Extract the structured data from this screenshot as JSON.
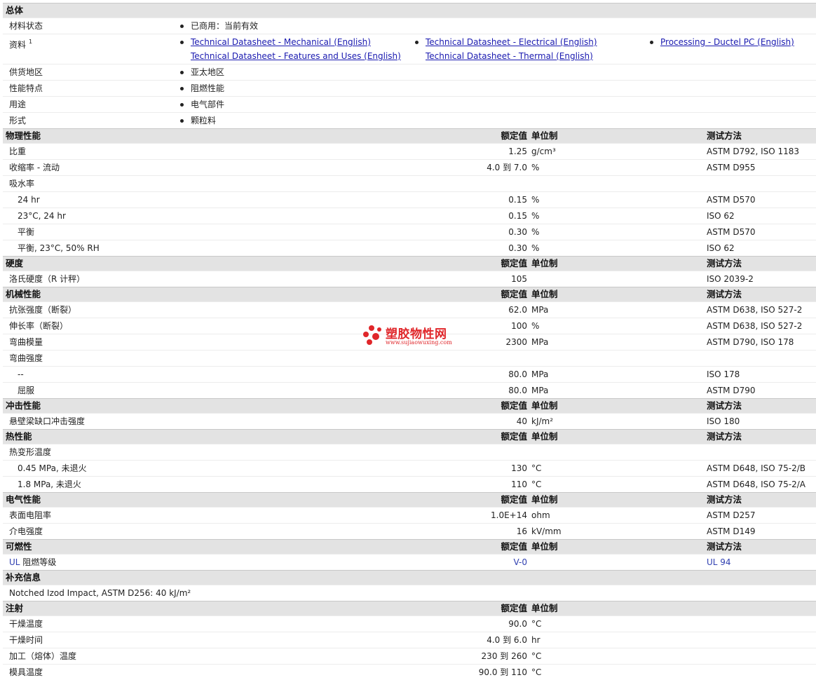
{
  "general": {
    "title": "总体",
    "status_label": "材料状态",
    "status_value": "已商用：当前有效",
    "docs_label": "资料",
    "docs_sup": "1",
    "docs": [
      "Technical Datasheet - Mechanical (English)",
      "Technical Datasheet - Electrical (English)",
      "Processing - Ductel PC (English)",
      "Technical Datasheet - Features and Uses (English)",
      "Technical Datasheet - Thermal (English)"
    ],
    "region_label": "供货地区",
    "region_value": "亚太地区",
    "feature_label": "性能特点",
    "feature_value": "阻燃性能",
    "use_label": "用途",
    "use_value": "电气部件",
    "form_label": "形式",
    "form_value": "颗粒料"
  },
  "columns": {
    "value": "额定值",
    "unit": "单位制",
    "method": "测试方法"
  },
  "physical": {
    "title": "物理性能",
    "rows": [
      {
        "label": "比重",
        "value": "1.25",
        "unit": "g/cm³",
        "method": "ASTM D792, ISO 1183"
      },
      {
        "label": "收缩率 - 流动",
        "value": "4.0 到  7.0",
        "unit": "%",
        "method": "ASTM D955"
      },
      {
        "label": "吸水率",
        "value": "",
        "unit": "",
        "method": ""
      },
      {
        "label": "24 hr",
        "value": "0.15",
        "unit": "%",
        "method": "ASTM D570"
      },
      {
        "label": "23°C, 24 hr",
        "value": "0.15",
        "unit": "%",
        "method": "ISO 62"
      },
      {
        "label": "平衡",
        "value": "0.30",
        "unit": "%",
        "method": "ASTM D570"
      },
      {
        "label": "平衡, 23°C, 50% RH",
        "value": "0.30",
        "unit": "%",
        "method": "ISO 62"
      }
    ]
  },
  "hardness": {
    "title": "硬度",
    "rows": [
      {
        "label": "洛氏硬度（R 计秤）",
        "value": "105",
        "unit": "",
        "method": "ISO 2039-2"
      }
    ]
  },
  "mechanical": {
    "title": "机械性能",
    "rows": [
      {
        "label": "抗张强度（断裂）",
        "value": "62.0",
        "unit": "MPa",
        "method": "ASTM D638, ISO 527-2"
      },
      {
        "label": "伸长率（断裂）",
        "value": "100",
        "unit": "%",
        "method": "ASTM D638, ISO 527-2"
      },
      {
        "label": "弯曲模量",
        "value": "2300",
        "unit": "MPa",
        "method": "ASTM D790, ISO 178"
      },
      {
        "label": "弯曲强度",
        "value": "",
        "unit": "",
        "method": ""
      },
      {
        "label": "--",
        "value": "80.0",
        "unit": "MPa",
        "method": "ISO 178"
      },
      {
        "label": "屈服",
        "value": "80.0",
        "unit": "MPa",
        "method": "ASTM D790"
      }
    ]
  },
  "impact": {
    "title": "冲击性能",
    "rows": [
      {
        "label": "悬壁梁缺口冲击强度",
        "value": "40",
        "unit": "kJ/m²",
        "method": "ISO 180"
      }
    ]
  },
  "thermal": {
    "title": "热性能",
    "rows": [
      {
        "label": "热变形温度",
        "value": "",
        "unit": "",
        "method": ""
      },
      {
        "label": "0.45 MPa, 未退火",
        "value": "130",
        "unit": "°C",
        "method": "ASTM D648, ISO 75-2/B"
      },
      {
        "label": "1.8 MPa, 未退火",
        "value": "110",
        "unit": "°C",
        "method": "ASTM D648, ISO 75-2/A"
      }
    ]
  },
  "electrical": {
    "title": "电气性能",
    "rows": [
      {
        "label": "表面电阻率",
        "value": "1.0E+14",
        "unit": "ohm",
        "method": "ASTM D257"
      },
      {
        "label": "介电强度",
        "value": "16",
        "unit": "kV/mm",
        "method": "ASTM D149"
      }
    ]
  },
  "flammability": {
    "title": "可燃性",
    "rows": [
      {
        "label_prefix": "UL",
        "label": "阻燃等级",
        "value": "V-0",
        "unit": "",
        "method": "UL 94"
      }
    ]
  },
  "supplement": {
    "title": "补充信息",
    "text": "Notched Izod Impact, ASTM D256: 40 kJ/m²"
  },
  "injection": {
    "title": "注射",
    "rows": [
      {
        "label": "干燥温度",
        "value": "90.0",
        "unit": "°C"
      },
      {
        "label": "干燥时间",
        "value": "4.0 到  6.0",
        "unit": "hr"
      },
      {
        "label": "加工（熔体）温度",
        "value": "230 到  260",
        "unit": "°C"
      },
      {
        "label": "模具温度",
        "value": "90.0 到  110",
        "unit": "°C"
      }
    ]
  },
  "watermark": {
    "title": "塑胶物性网",
    "url": "www.sujiaowuxing.com"
  },
  "colors": {
    "header_bg": "#e3e3e3",
    "link": "#1a1ab0",
    "watermark": "#e0262a"
  }
}
